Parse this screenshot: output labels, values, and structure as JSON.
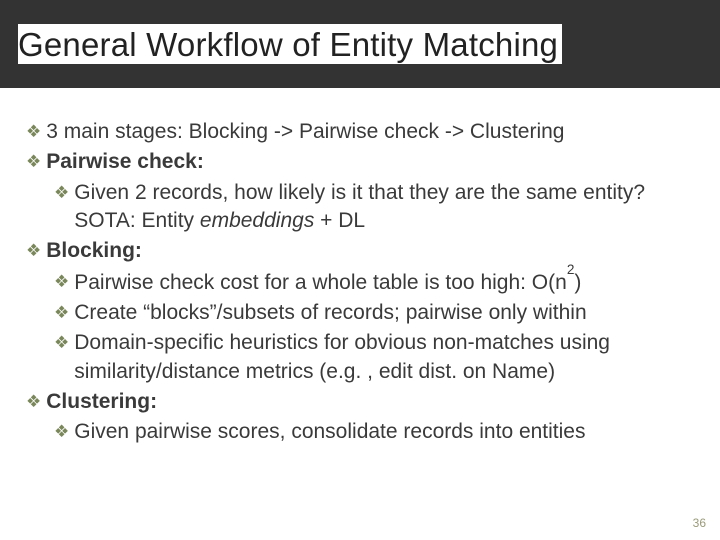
{
  "header": {
    "title": "General Workflow of Entity Matching"
  },
  "b": {
    "stages": "3 main stages: Blocking -> Pairwise check -> Clustering",
    "pairwise_label": "Pairwise check:",
    "pairwise_a1": "Given 2 records, how likely is it that they are the same entity? SOTA: Entity ",
    "pairwise_a2": "embeddings",
    "pairwise_a3": " + DL",
    "blocking_label": "Blocking:",
    "blocking_a_1": "Pairwise check cost for a whole table is too high: O(n",
    "blocking_a_sup": "2",
    "blocking_a_2": ")",
    "blocking_b": "Create “blocks”/subsets of records; pairwise only within",
    "blocking_c": "Domain-specific heuristics for obvious non-matches using similarity/distance metrics (e.g. , edit dist. on Name)",
    "clustering_label": "Clustering:",
    "clustering_a": "Given pairwise scores, consolidate records into entities"
  },
  "page_number": "36"
}
